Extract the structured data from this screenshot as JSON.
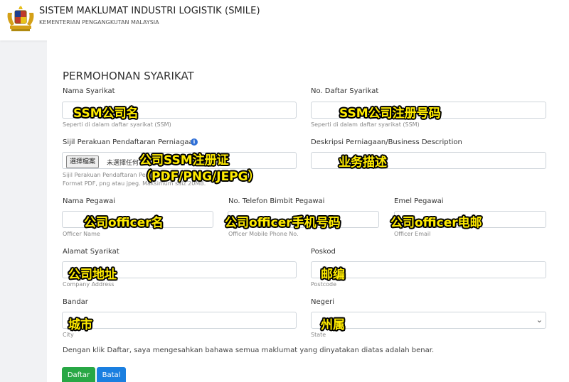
{
  "header": {
    "title": "SISTEM MAKLUMAT INDUSTRI LOGISTIK (SMILE)",
    "subtitle": "KEMENTERIAN PENGANGKUTAN MALAYSIA",
    "logo_icon": "malaysia-coat-of-arms-icon"
  },
  "form": {
    "title": "PERMOHONAN SYARIKAT",
    "nama_syarikat": {
      "label": "Nama Syarikat",
      "hint": "Seperti di dalam daftar syarikat (SSM)",
      "value": ""
    },
    "no_daftar": {
      "label": "No. Daftar Syarikat",
      "hint": "Seperti di dalam daftar syarikat (SSM)",
      "value": ""
    },
    "sijil": {
      "label": "Sijil Perakuan Pendaftaran Perniagaan",
      "button": "選擇檔案",
      "status": "未選擇任何",
      "hint1": "Sijil Perakuan Pendaftaran Pern",
      "hint2": "Format PDF, png atau jpeg. Maksimum saiz 20MB."
    },
    "deskripsi": {
      "label": "Deskripsi Perniagaan/Business Description",
      "value": ""
    },
    "nama_pegawai": {
      "label": "Nama Pegawai",
      "hint": "Officer Name",
      "value": ""
    },
    "telefon": {
      "label": "No. Telefon Bimbit Pegawai",
      "hint": "Officer Mobile Phone No.",
      "value": ""
    },
    "emel": {
      "label": "Emel Pegawai",
      "hint": "Officer Email",
      "value": ""
    },
    "alamat": {
      "label": "Alamat Syarikat",
      "hint": "Company Address",
      "value": ""
    },
    "poskod": {
      "label": "Poskod",
      "hint": "Postcode",
      "value": ""
    },
    "bandar": {
      "label": "Bandar",
      "hint": "City",
      "value": ""
    },
    "negeri": {
      "label": "Negeri",
      "hint": "State",
      "selected": ""
    },
    "consent": "Dengan klik Daftar, saya mengesahkan bahawa semua maklumat yang dinyatakan diatas adalah benar.",
    "submit_label": "Daftar",
    "cancel_label": "Batal"
  },
  "annotations": {
    "ssm_name": "SSM公司名",
    "ssm_reg_no": "SSM公司注册号码",
    "cert_line1": "公司SSM注册证",
    "cert_line2": "（PDF/PNG/JEPG）",
    "business_desc": "业务描述",
    "officer_name": "公司officer名",
    "officer_phone": "公司officer手机号码",
    "officer_email": "公司officer电邮",
    "company_address": "公司地址",
    "postcode": "邮编",
    "city": "城市",
    "state": "州属"
  }
}
